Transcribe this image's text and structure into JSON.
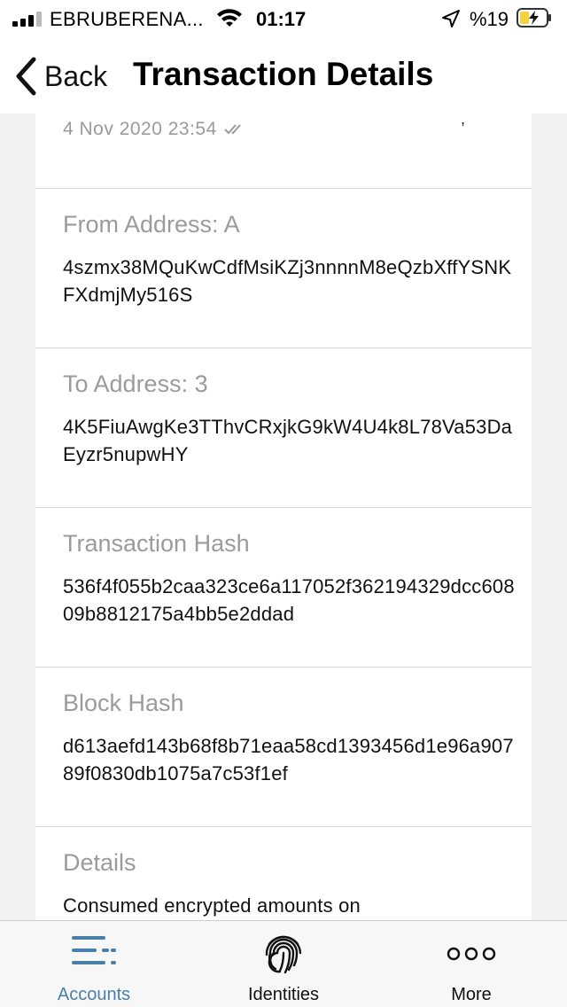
{
  "status_bar": {
    "carrier": "EBRUBERENA...",
    "time": "01:17",
    "battery_percent": "%19"
  },
  "nav": {
    "back_label": "Back",
    "title": "Transaction Details"
  },
  "transaction": {
    "timestamp": "4 Nov 2020 23:54",
    "sections": [
      {
        "label": "From Address: A",
        "value": "4szmx38MQuKwCdfMsiKZj3nnnnM8eQzbXffYSNKFXdmjMy516S"
      },
      {
        "label": "To Address: 3",
        "value": "4K5FiuAwgKe3TThvCRxjkG9kW4U4k8L78Va53DaEyzr5nupwHY"
      },
      {
        "label": "Transaction Hash",
        "value": "536f4f055b2caa323ce6a117052f362194329dcc60809b8812175a4bb5e2ddad"
      },
      {
        "label": "Block Hash",
        "value": "d613aefd143b68f8b71eaa58cd1393456d1e96a90789f0830db1075a7c53f1ef"
      },
      {
        "label": "Details",
        "value": "Consumed encrypted amounts on"
      }
    ]
  },
  "tab_bar": {
    "tabs": [
      {
        "label": "Accounts",
        "icon": "accounts-list-icon",
        "active": true
      },
      {
        "label": "Identities",
        "icon": "fingerprint-icon",
        "active": false
      },
      {
        "label": "More",
        "icon": "more-dots-icon",
        "active": false
      }
    ]
  },
  "colors": {
    "accent": "#4a7fa8",
    "label_gray": "#9b9b9b",
    "background": "#f2f2f2",
    "battery_yellow": "#f5d33c"
  }
}
